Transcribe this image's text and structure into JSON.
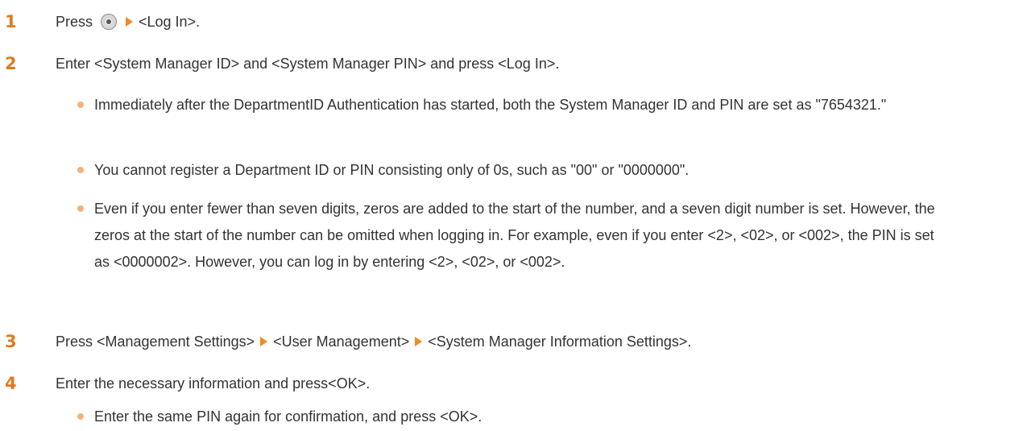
{
  "steps": [
    {
      "number": "1",
      "text_before": "Press",
      "icon": "home-button-icon",
      "text_after": "<Log In>."
    },
    {
      "number": "2",
      "text": "Enter <System Manager ID> and <System Manager PIN> and press <Log In>.",
      "bullets": [
        "Immediately after the DepartmentID Authentication has started, both the System Manager ID and PIN are set as \"7654321.\"",
        "You cannot register a Department ID or PIN consisting only of 0s, such as \"00\" or \"0000000\".",
        "Even if you enter fewer than seven digits, zeros are added to the start of the number, and a seven digit number is set. However, the zeros at the start of the number can be omitted when logging in. For example, even if you enter <2>, <02>, or <002>, the PIN is set as <0000002>. However, you can log in by entering <2>, <02>, or <002>."
      ]
    },
    {
      "number": "3",
      "parts": [
        "Press <Management Settings>",
        "<User Management>",
        "<System Manager Information Settings>."
      ]
    },
    {
      "number": "4",
      "text": "Enter the necessary information and press<OK>.",
      "bullets": [
        "Enter the same PIN again for confirmation, and press <OK>."
      ]
    }
  ],
  "colors": {
    "step_number": "#e07a1f",
    "arrow": "#f08a24",
    "bullet": "#f3b27a",
    "text": "#333333"
  }
}
